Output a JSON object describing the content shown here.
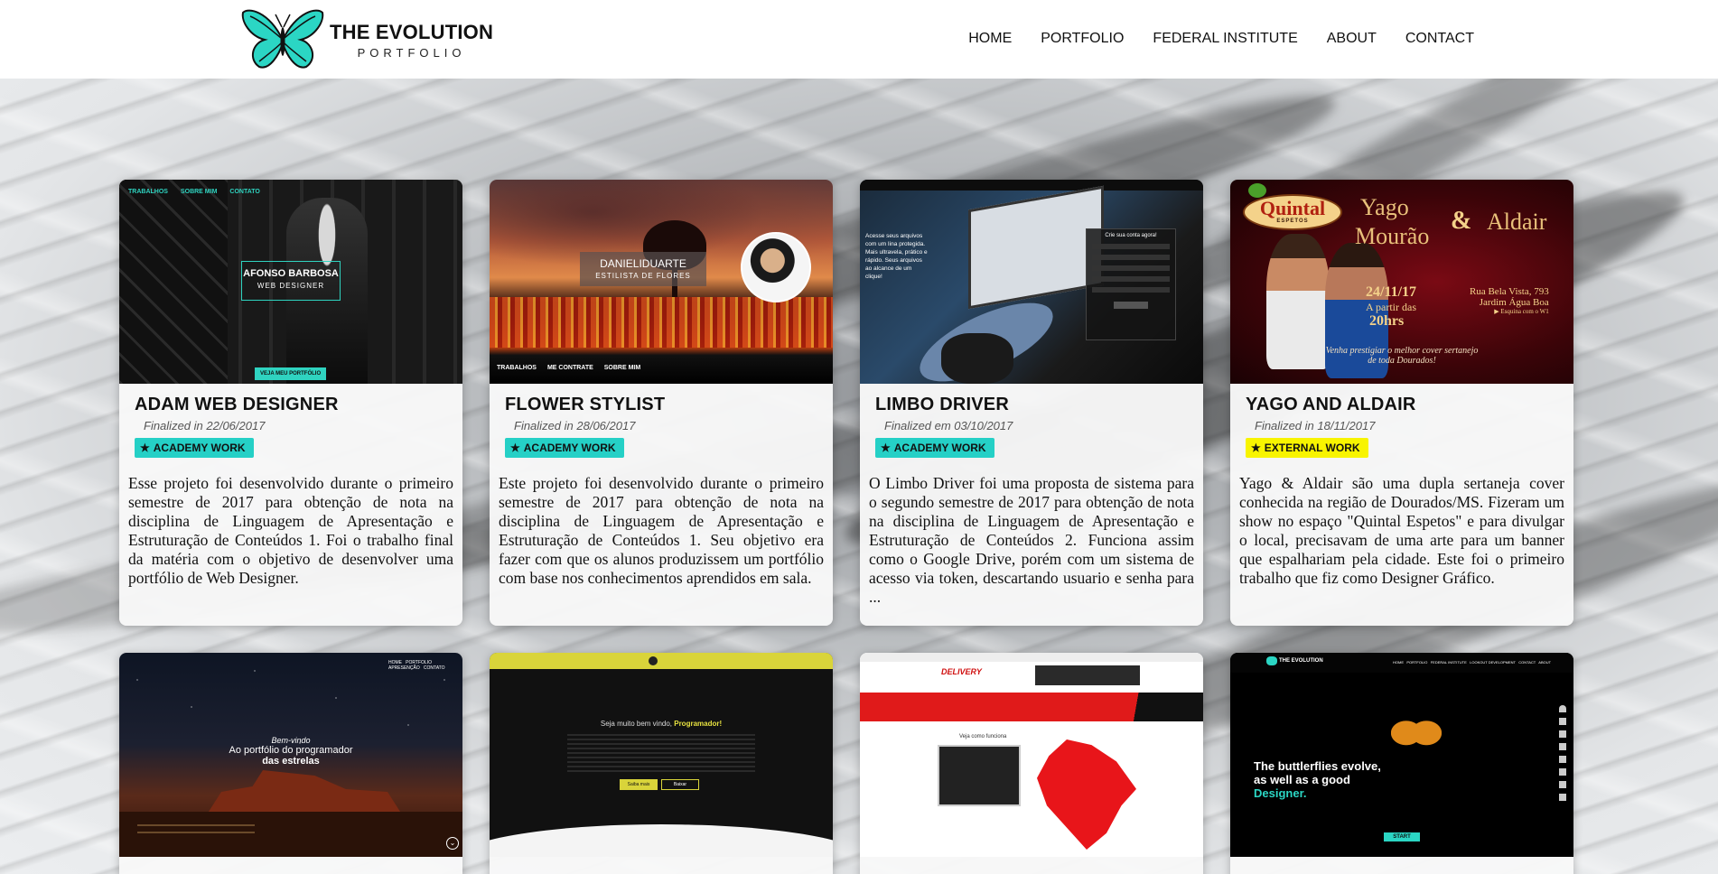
{
  "header": {
    "logo_title": "THE EVOLUTION",
    "logo_subtitle": "PORTFOLIO",
    "nav": [
      "HOME",
      "PORTFOLIO",
      "FEDERAL INSTITUTE",
      "ABOUT",
      "CONTACT"
    ]
  },
  "colors": {
    "academy": "#25d0c6",
    "external": "#f8f400",
    "accent": "#25d0c6"
  },
  "cards": [
    {
      "title": "ADAM WEB DESIGNER",
      "date": "Finalized in 22/06/2017",
      "badge": "ACADEMY WORK",
      "description": "Esse projeto foi desenvolvido durante o primeiro semestre de 2017 para obtenção de nota na disciplina de Linguagem de Apresentação e Estruturação de Conteúdos 1. Foi o trabalho final da matéria com o objetivo de desenvolver uma portfólio de Web Designer.",
      "preview": {
        "nav": [
          "TRABALHOS",
          "SOBRE MIM",
          "CONTATO"
        ],
        "name": "AFONSO BARBOSA",
        "role": "WEB DESIGNER",
        "button": "VEJA MEU PORTFÓLIO"
      }
    },
    {
      "title": "FLOWER STYLIST",
      "date": "Finalized in 28/06/2017",
      "badge": "ACADEMY WORK",
      "description": "Este projeto foi desenvolvido durante o primeiro semestre de 2017 para obtenção de nota na disciplina de Linguagem de Apresentação e Estruturação de Conteúdos 1. Seu objetivo era fazer com que os alunos produzissem um portfólio com base nos conhecimentos aprendidos em sala.",
      "preview": {
        "name": "DANIELIDUARTE",
        "role": "ESTILISTA DE FLORES",
        "nav": [
          "TRABALHOS",
          "ME CONTRATE",
          "SOBRE MIM"
        ]
      }
    },
    {
      "title": "LIMBO DRIVER",
      "date": "Finalized em 03/10/2017",
      "badge": "ACADEMY WORK",
      "description": "O Limbo Driver foi uma proposta de sistema para o segundo semestre de 2017 para obtenção de nota na disciplina de Linguagem de Apresentação e Estruturação de Conteúdos 2. Funciona assim como o Google Drive, porém com um sistema de acesso via token, descartando usuario e senha para ...",
      "preview": {
        "tagline": "Acesse seus arquivos com um Iina protegida. Mais ultravela, prático e rápido. Seus arquivos ao alcance de um clique!",
        "panel_title": "Crie sua conta agora!"
      }
    },
    {
      "title": "YAGO AND ALDAIR",
      "date": "Finalized in 18/11/2017",
      "badge": "EXTERNAL WORK",
      "description": "Yago & Aldair são uma dupla sertaneja cover conhecida na região de Dourados/MS. Fizeram um show no espaço \"Quintal Espetos\" e para divulgar o local, precisavam de uma arte para um banner que espalhariam pela cidade. Este foi o primeiro trabalho que fiz como Designer Gráfico.",
      "preview": {
        "brand": "Quintal",
        "brand_sub": "ESPETOS",
        "yago": "Yago",
        "mourao": "Mourão",
        "amp": "&",
        "aldair": "Aldair",
        "date": "24/11/17",
        "from": "A partir das",
        "time": "20hrs",
        "address1": "Rua Bela Vista, 793",
        "address2": "Jardim Água Boa",
        "address3": "▶ Esquina com o W1",
        "footer1": "Venha prestigiar o melhor cover sertanejo",
        "footer2": "de toda Dourados!"
      }
    }
  ],
  "row2": [
    {
      "line1": "Bem-vindo",
      "line2": "Ao portfólio do programador",
      "line3": "das estrelas"
    },
    {
      "welcome": "Seja muito bem vindo, ",
      "highlight": "Programador!",
      "btn1": "Saiba mais",
      "btn2": "Baixar"
    },
    {
      "brand": "DELIVERY",
      "caption": "Veja como funciona"
    },
    {
      "logo": "THE EVOLUTION",
      "line1": "The buttlerflies evolve,",
      "line2": "as well as a good",
      "line3": "Designer.",
      "button": "START"
    }
  ]
}
